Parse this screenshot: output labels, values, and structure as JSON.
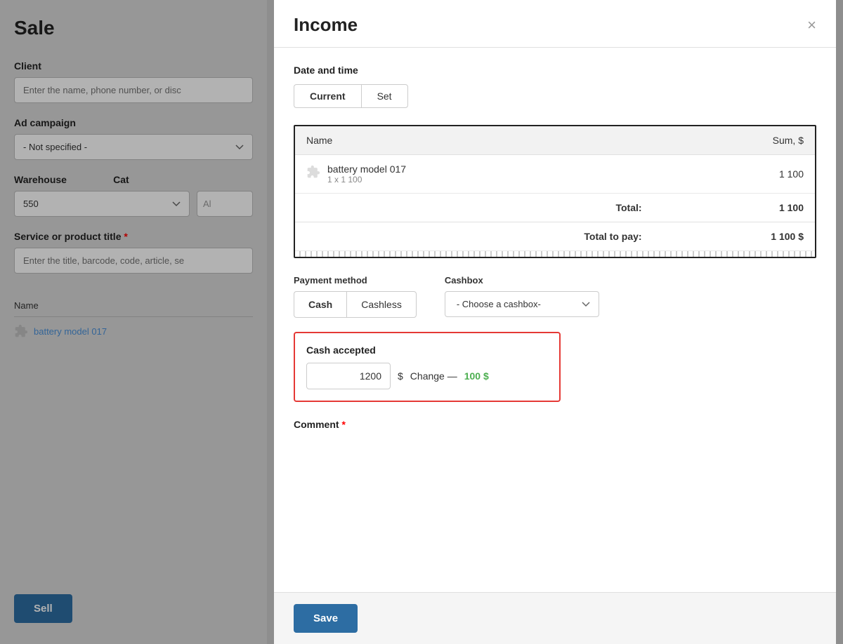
{
  "sale": {
    "title": "Sale",
    "client": {
      "label": "Client",
      "placeholder": "Enter the name, phone number, or disc"
    },
    "ad_campaign": {
      "label": "Ad campaign",
      "options": [
        "- Not specified -"
      ],
      "selected": "- Not specified -"
    },
    "warehouse": {
      "label": "Warehouse",
      "cat_label": "Cat",
      "warehouse_value": "550",
      "cat_placeholder": "Al"
    },
    "product_title": {
      "label": "Service or product title",
      "required": true,
      "placeholder": "Enter the title, barcode, code, article, se"
    },
    "table": {
      "name_col": "Name",
      "product": "battery model 017"
    },
    "sell_button": "Sell"
  },
  "modal": {
    "title": "Income",
    "close": "×",
    "date_time": {
      "label": "Date and time",
      "current_btn": "Current",
      "set_btn": "Set"
    },
    "receipt": {
      "col_name": "Name",
      "col_sum": "Sum, $",
      "items": [
        {
          "name": "battery model 017",
          "sub": "1 x 1 100",
          "sum": "1 100"
        }
      ],
      "total_label": "Total:",
      "total_value": "1 100",
      "total_pay_label": "Total to pay:",
      "total_pay_value": "1 100 $"
    },
    "payment": {
      "method_label": "Payment method",
      "cash_btn": "Cash",
      "cashless_btn": "Cashless",
      "cashbox_label": "Cashbox",
      "cashbox_placeholder": "- Choose a cashbox-"
    },
    "cash_accepted": {
      "label": "Cash accepted",
      "value": "1200",
      "currency": "$",
      "change_text": "Change —",
      "change_amount": "100 $"
    },
    "comment": {
      "label": "Comment",
      "required": true
    },
    "save_btn": "Save"
  }
}
